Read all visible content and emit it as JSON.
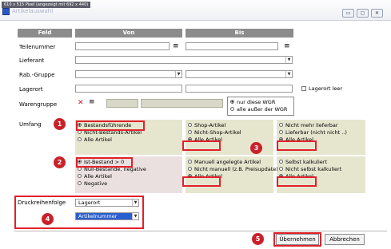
{
  "titlebar": {
    "size_info": "610 x 515 Pixel (angezeigt mit 692 x 440)",
    "title": "Artikelauswahl",
    "min": "▭",
    "max": "▢",
    "close": "✕"
  },
  "headers": {
    "feld": "Feld",
    "von": "Von",
    "bis": "Bis"
  },
  "rows": {
    "teilenummer": "Teilenummer",
    "lieferant": "Lieferant",
    "rabgruppe": "Rab.-Gruppe",
    "lagerort": "Lagerort",
    "lagerort_leer": "Lagerort leer",
    "warengruppe": "Warengruppe"
  },
  "wgr": {
    "opt1": "nur diese WGR",
    "opt2": "alle außer der WGR"
  },
  "umfang": {
    "label": "Umfang",
    "col1": [
      "Bestandsführende",
      "Nicht-Bestands-Artikel",
      "Alle Artikel"
    ],
    "col2": [
      "Shop-Artikel",
      "Nicht-Shop-Artikel",
      "Alle Artikel"
    ],
    "col3": [
      "Nicht mehr lieferbar",
      "Lieferbar (nicht nicht ..)",
      "Alle Artikel"
    ]
  },
  "bestand": {
    "col1": [
      "Ist-Bestand > 0",
      "Null-Bestände, negative",
      "Alle Artikel",
      "Negative"
    ],
    "col2": [
      "Manuell angelegte Artikel",
      "Nicht manuell (z.B. Preisupdate)",
      "Alle Artikel"
    ],
    "col3": [
      "Selbst kalkuliert",
      "Nicht selbst kalkuliert",
      "Alle Artikel"
    ]
  },
  "druck": {
    "label": "Druckreihenfolge",
    "sort1": "Lagerort",
    "sort2": "Artikelnummer"
  },
  "buttons": {
    "ok": "Übernehmen",
    "cancel": "Abbrechen"
  },
  "badges": {
    "b1": "1",
    "b2": "2",
    "b3": "3",
    "b4": "4",
    "b5": "5"
  },
  "icons": {
    "menu": "≡",
    "delete": "✕",
    "arrow": "▼"
  }
}
